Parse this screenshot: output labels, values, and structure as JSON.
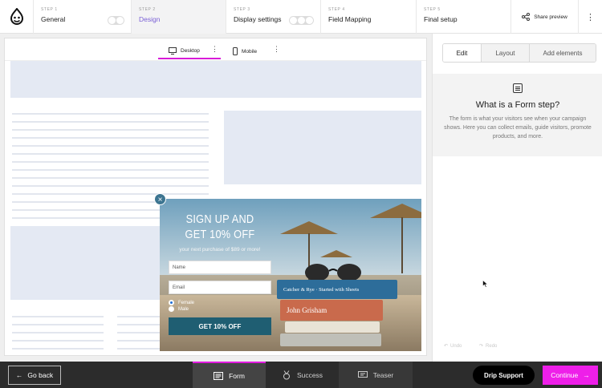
{
  "steps": [
    {
      "num": "STEP 1",
      "title": "General"
    },
    {
      "num": "STEP 2",
      "title": "Design"
    },
    {
      "num": "STEP 3",
      "title": "Display settings"
    },
    {
      "num": "STEP 4",
      "title": "Field Mapping"
    },
    {
      "num": "STEP 5",
      "title": "Final setup"
    }
  ],
  "header": {
    "share_label": "Share preview",
    "more_icon": "kebab-icon"
  },
  "device_tabs": {
    "desktop": "Desktop",
    "mobile": "Mobile"
  },
  "popup": {
    "headline_1": "SIGN UP AND",
    "headline_2": "GET 10% OFF",
    "subtext": "your next purchase of $89 or more!",
    "name_placeholder": "Name",
    "email_placeholder": "Email",
    "radio_female": "Female",
    "radio_male": "Male",
    "cta": "GET 10% OFF",
    "book_1": "Catcher & Rye · Started with Sheets",
    "book_2": "John Grisham",
    "book_3": "",
    "close_icon": "×"
  },
  "panel": {
    "tabs": [
      "Edit",
      "Layout",
      "Add elements"
    ],
    "active_tab": "Edit",
    "info_title": "What is a Form step?",
    "info_text": "The form is what your visitors see when your campaign shows. Here you can collect emails, guide visitors, promote products, and more.",
    "undo": "Undo",
    "redo": "Redo"
  },
  "bottom": {
    "go_back": "Go back",
    "tabs": [
      "Form",
      "Success",
      "Teaser"
    ],
    "active_tab": "Form",
    "drip_support": "Drip Support",
    "continue": "Continue"
  },
  "colors": {
    "accent": "#ee1fe9",
    "active_step": "#7b61d6",
    "cta": "#1f5e72"
  }
}
